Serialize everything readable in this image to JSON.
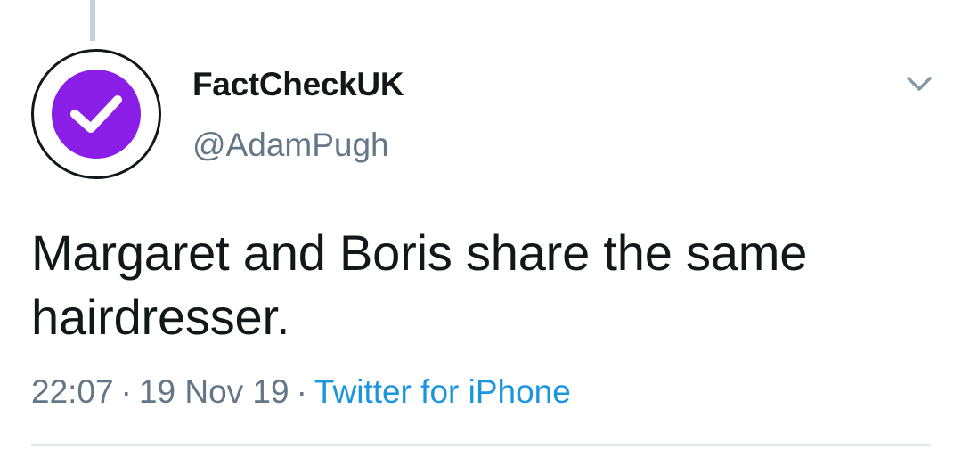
{
  "tweet": {
    "display_name": "FactCheckUK",
    "handle": "@AdamPugh",
    "text_line1": "Margaret and Boris share the same",
    "text_line2": "hairdresser.",
    "time": "22:07",
    "date": "19 Nov 19",
    "separator": "·",
    "source": "Twitter for iPhone"
  },
  "icons": {
    "avatar": "purple-checkmark-icon",
    "menu": "chevron-down-icon"
  },
  "colors": {
    "avatar_purple": "#8a1ee6",
    "text": "#14171a",
    "secondary": "#657786",
    "link": "#1b95e0"
  }
}
